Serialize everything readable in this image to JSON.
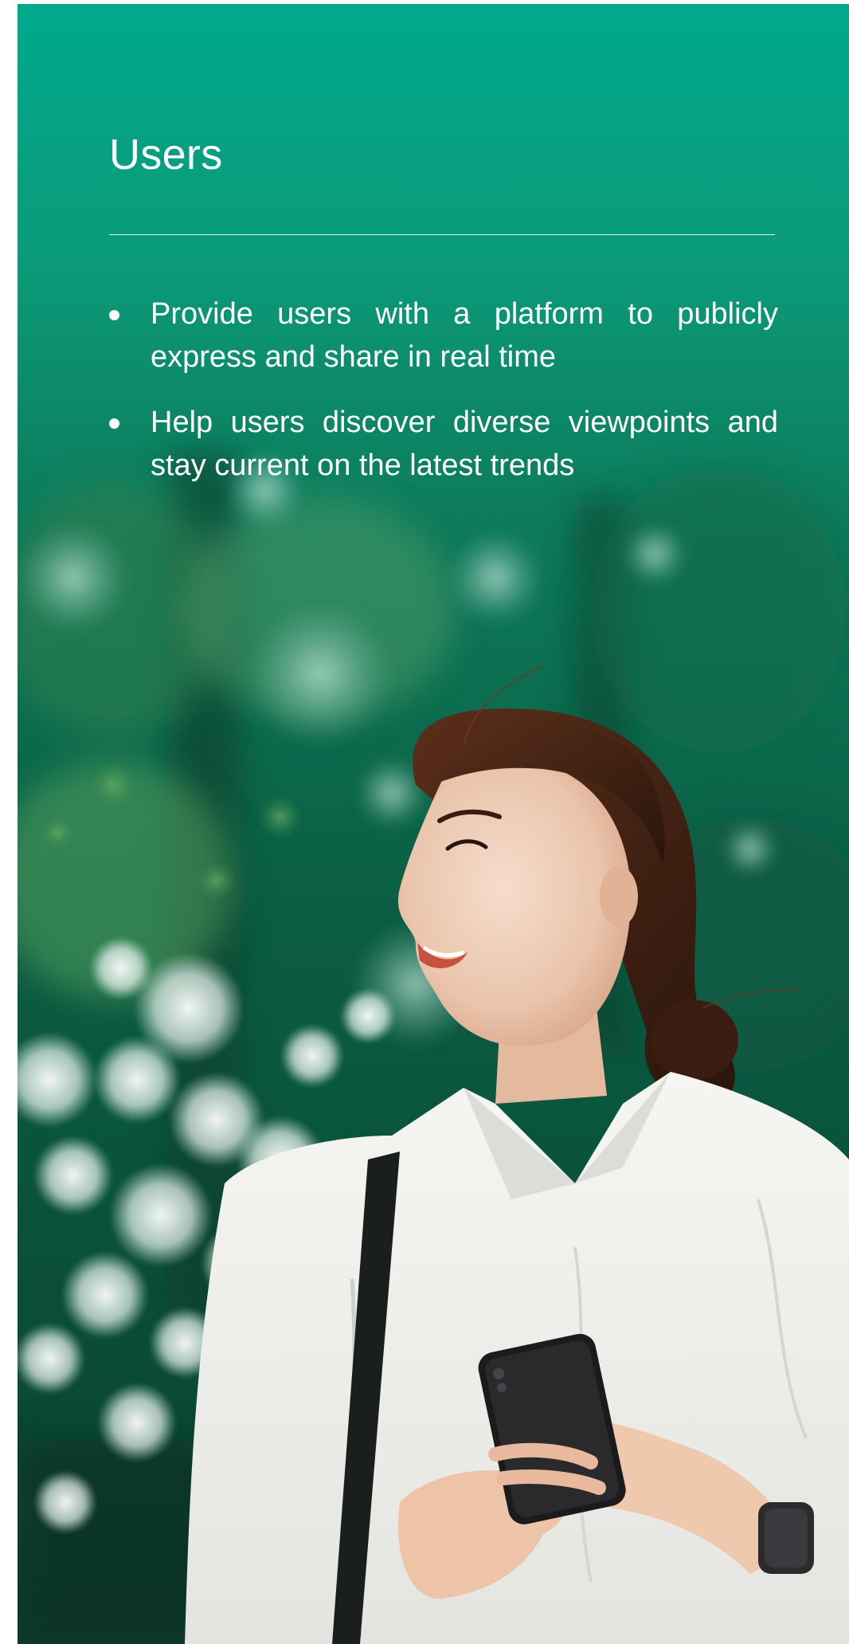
{
  "section": {
    "title": "Users",
    "bullets": [
      "Provide users with a platform to publicly express and share in real time",
      "Help users discover diverse viewpoints and stay current on the latest trends"
    ]
  },
  "colors": {
    "teal_top": "#00a98c",
    "forest_dark": "#0b5a3f",
    "shirt_white": "#f3f3f0",
    "text": "#ffffff"
  },
  "photo": {
    "subject_icon": "woman-holding-smartphone-photo"
  }
}
